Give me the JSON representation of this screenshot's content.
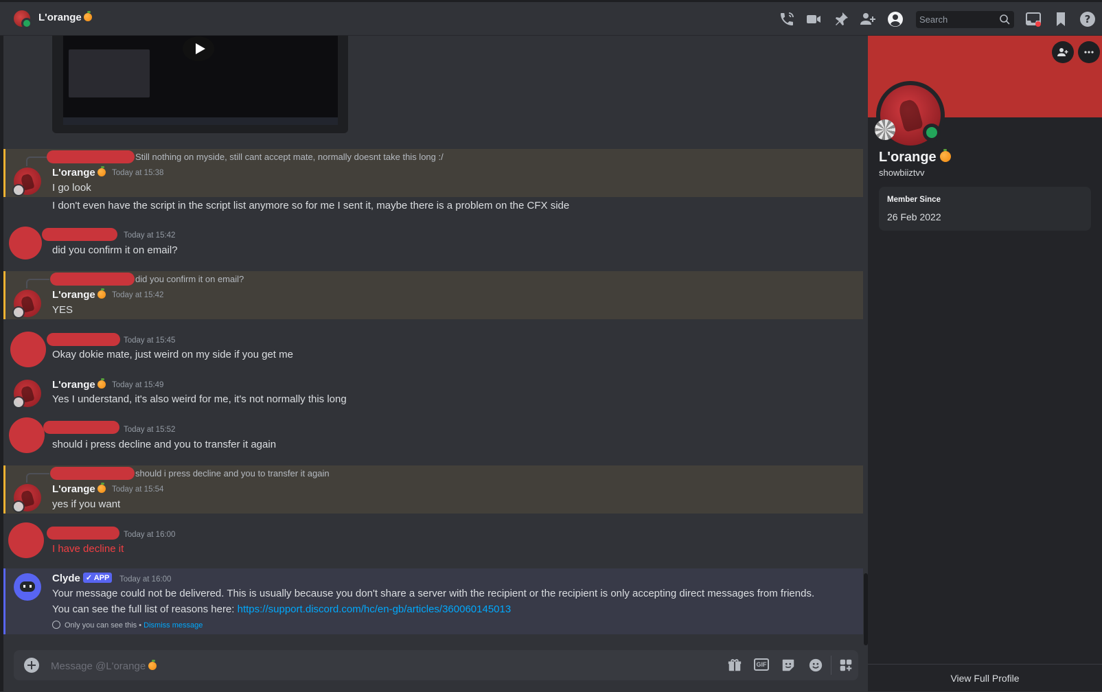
{
  "header": {
    "title": "L'orange",
    "search_placeholder": "Search"
  },
  "messages": [
    {
      "reply_text": "Still nothing on myside, still cant accept mate, normally doesnt take this long :/",
      "author": "L'orange",
      "timestamp": "Today at 15:38",
      "lines": [
        "I go look",
        "I don't even have the script in the script list anymore so for me I sent it, maybe there is a problem on the CFX side"
      ]
    },
    {
      "timestamp": "Today at 15:42",
      "lines": [
        "did you confirm it on email?"
      ]
    },
    {
      "reply_text": "did you confirm it on email?",
      "author": "L'orange",
      "timestamp": "Today at 15:42",
      "lines": [
        "YES"
      ]
    },
    {
      "timestamp": "Today at 15:45",
      "lines": [
        "Okay dokie mate, just weird on my side if you get me"
      ]
    },
    {
      "author": "L'orange",
      "timestamp": "Today at 15:49",
      "lines": [
        "Yes I understand, it's also weird for me, it's not normally this long"
      ]
    },
    {
      "timestamp": "Today at 15:52",
      "lines": [
        "should i press decline and you to transfer it again"
      ]
    },
    {
      "reply_text": "should i press decline and you to transfer it again",
      "author": "L'orange",
      "timestamp": "Today at 15:54",
      "lines": [
        "yes if you want"
      ]
    },
    {
      "timestamp": "Today at 16:00",
      "lines": [
        "I have decline it"
      ]
    },
    {
      "author": "Clyde",
      "badge": "APP",
      "timestamp": "Today at 16:00",
      "lines": [
        "Your message could not be delivered. This is usually because you don't share a server with the recipient or the recipient is only accepting direct messages from friends.",
        "You can see the full list of reasons here: "
      ],
      "link": "https://support.discord.com/hc/en-gb/articles/360060145013",
      "notice": "Only you can see this",
      "separator": " • ",
      "dismiss": "Dismiss message"
    }
  ],
  "composer": {
    "placeholder": "Message @L'orange"
  },
  "profile": {
    "name": "L'orange",
    "handle": "showbiiztvv",
    "member_since_label": "Member Since",
    "member_since": "26 Feb 2022",
    "footer": "View Full Profile"
  },
  "colors": {
    "accent": "#5865f2",
    "highlight": "#f0b232",
    "banner": "#b8312f",
    "online": "#23a55a",
    "error": "#f23f43",
    "link": "#00a8fc"
  }
}
